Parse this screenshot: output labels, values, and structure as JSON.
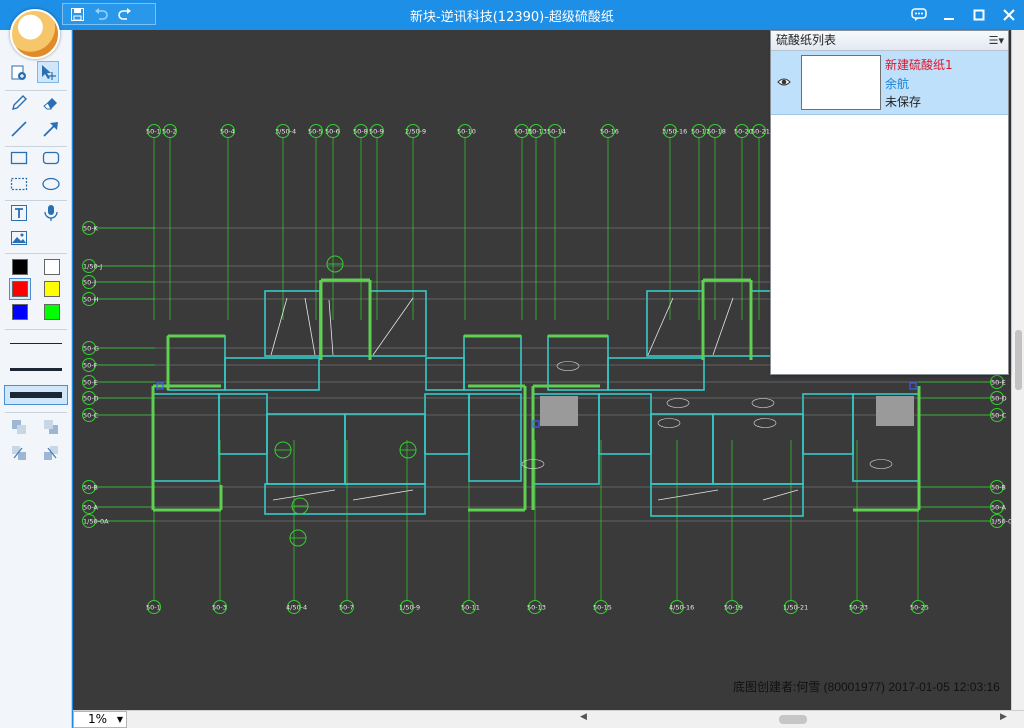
{
  "window": {
    "title": "新块-逆讯科技(12390)-超级硫酸纸"
  },
  "panel": {
    "title": "硫酸纸列表",
    "item": {
      "name": "新建硫酸纸1",
      "owner": "余航",
      "status": "未保存"
    }
  },
  "canvas": {
    "creator": "底图创建者:何雪 (80001977) 2017-01-05 12:03:16"
  },
  "status": {
    "zoom": "1%"
  },
  "colors": {
    "titlebar": "#1e8fe6",
    "canvas_bg": "#3a3a3a",
    "axis_green": "#34d12f",
    "wall_cyan": "#37c9c7",
    "panel_selected": "#bfe0fa",
    "name_red": "#e0142b",
    "owner_blue": "#1a83d8"
  },
  "palette": [
    "#000000",
    "#ffffff",
    "#ff0000",
    "#ffff00",
    "#0000ff",
    "#00ff00"
  ],
  "drawing": {
    "top_axes": [
      "50-1",
      "50-2",
      "50-4",
      "3/50-4",
      "50-5",
      "50-6",
      "50-8",
      "50-9",
      "2/50-9",
      "50-10",
      "50-11",
      "50-13",
      "50-14",
      "50-16",
      "3/50-16",
      "50-17",
      "50-18",
      "50-20",
      "50-21"
    ],
    "bottom_axes": [
      "50-1",
      "50-3",
      "4/50-4",
      "50-7",
      "1/50-9",
      "50-11",
      "50-13",
      "50-15",
      "4/50-16",
      "50-19",
      "1/50-21",
      "50-23",
      "50-25"
    ],
    "left_axes": [
      "50-K",
      "1/50-J",
      "50-J",
      "50-H",
      "50-G",
      "50-F",
      "50-E",
      "50-D",
      "50-C",
      "50-B",
      "50-A",
      "1/50-0A"
    ],
    "right_axes": [
      "50-E",
      "50-D",
      "50-C",
      "50-B",
      "50-A",
      "1/50-0A"
    ]
  }
}
